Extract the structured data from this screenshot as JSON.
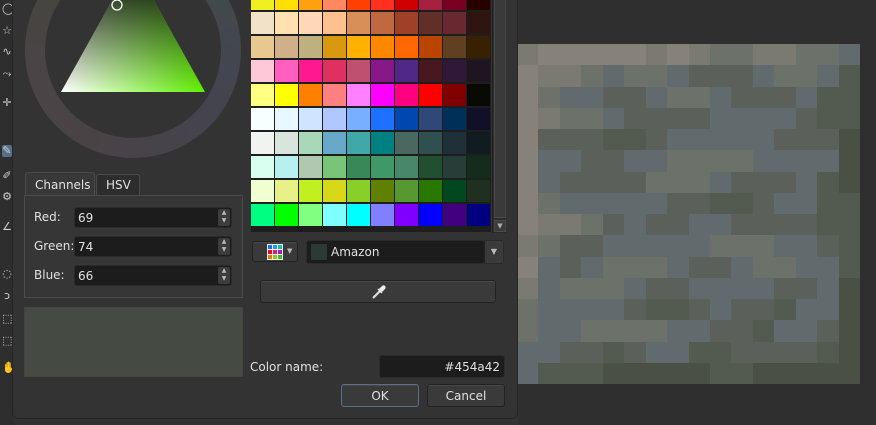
{
  "tabs": {
    "channels": "Channels",
    "hsv": "HSV"
  },
  "channels": [
    {
      "label": "Red:",
      "value": "69"
    },
    {
      "label": "Green:",
      "value": "74"
    },
    {
      "label": "Blue:",
      "value": "66"
    }
  ],
  "preview": {
    "old_color": "#454a42",
    "new_color": "#454a42"
  },
  "palette": {
    "selected": "Amazon",
    "selected_color": "#2b3a34",
    "rows": [
      [
        "#f0f020",
        "#ffe000",
        "#ffa010",
        "#ff8860",
        "#ff4000",
        "#ff3020",
        "#d00000",
        "#a82040",
        "#780020",
        "#280000"
      ],
      [
        "#f2e2c8",
        "#ffe0b0",
        "#ffd8b8",
        "#ffc090",
        "#d89058",
        "#c06840",
        "#a04028",
        "#603028",
        "#682830",
        "#301410"
      ],
      [
        "#e8c890",
        "#d0b088",
        "#c0b080",
        "#d89810",
        "#ffb000",
        "#ff8800",
        "#ff6800",
        "#b84400",
        "#604020",
        "#382000"
      ],
      [
        "#ffc8d8",
        "#ff60c0",
        "#ff1890",
        "#e03060",
        "#c05070",
        "#881888",
        "#502888",
        "#481820",
        "#301838",
        "#201420"
      ],
      [
        "#ffff80",
        "#ffff00",
        "#ff8000",
        "#ff8080",
        "#ff80ff",
        "#ff00ff",
        "#ff0080",
        "#ff0000",
        "#800000",
        "#0a0a04"
      ],
      [
        "#f8ffff",
        "#e8f8ff",
        "#d0e4ff",
        "#b0c8ff",
        "#78b0ff",
        "#1e70ff",
        "#0048b0",
        "#304878",
        "#003058",
        "#101028"
      ],
      [
        "#f0f4f0",
        "#d8e4dc",
        "#a8d8b8",
        "#68a8c8",
        "#40a8a8",
        "#008080",
        "#486860",
        "#305050",
        "#203038",
        "#101c20"
      ],
      [
        "#d8fff0",
        "#b8f0f0",
        "#b0c8b0",
        "#78c478",
        "#388858",
        "#409868",
        "#488868",
        "#205030",
        "#283c38",
        "#142c1c"
      ],
      [
        "#f0ffd0",
        "#e8f088",
        "#c0f020",
        "#d8d818",
        "#88d028",
        "#608000",
        "#589830",
        "#287800",
        "#004820",
        "#203020"
      ],
      [
        "#00ff80",
        "#00ff00",
        "#80ff80",
        "#80ffff",
        "#00ffff",
        "#8080ff",
        "#8000ff",
        "#0000ff",
        "#400080",
        "#000080"
      ]
    ]
  },
  "color_name": {
    "label": "Color name:",
    "value": "#454a42"
  },
  "buttons": {
    "ok": "OK",
    "cancel": "Cancel"
  },
  "hue_color": "#5ff000"
}
